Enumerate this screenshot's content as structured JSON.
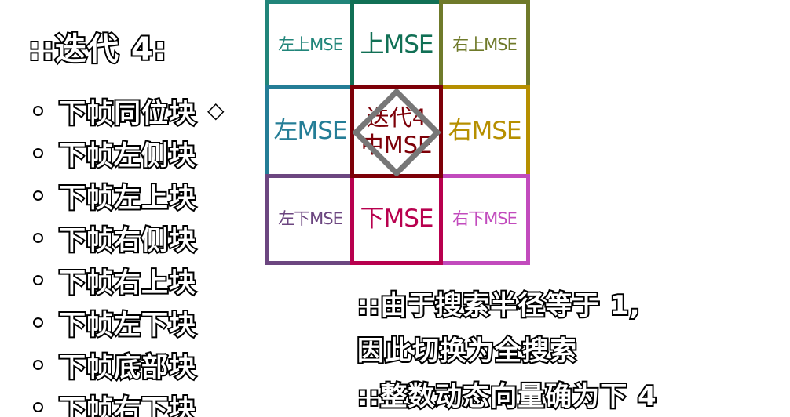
{
  "title": "::迭代 4:",
  "search_marker": "◇",
  "candidates": [
    "下帧同位块",
    "下帧左侧块",
    "下帧左上块",
    "下帧右侧块",
    "下帧右上块",
    "下帧左下块",
    "下帧底部块",
    "下帧右下块"
  ],
  "grid": {
    "top_left": "左上MSE",
    "top": "上MSE",
    "top_right": "右上MSE",
    "left": "左MSE",
    "center": "迭代4\n中MSE",
    "right": "右MSE",
    "bottom_left": "左下MSE",
    "bottom": "下MSE",
    "bottom_right": "右下MSE"
  },
  "notes": {
    "line1": "::由于搜索半径等于 1,",
    "line2": "因此切换为全搜索",
    "line3": "::整数动态向量确为下 4"
  },
  "colors": {
    "top_left": "#21857a",
    "top": "#117055",
    "top_right": "#6f7a2a",
    "left": "#247d96",
    "center": "#7d0008",
    "right": "#b68f00",
    "bottom_left": "#6c4680",
    "bottom": "#b8004e",
    "bottom_right": "#c24bbd",
    "diamond": "#777777"
  }
}
